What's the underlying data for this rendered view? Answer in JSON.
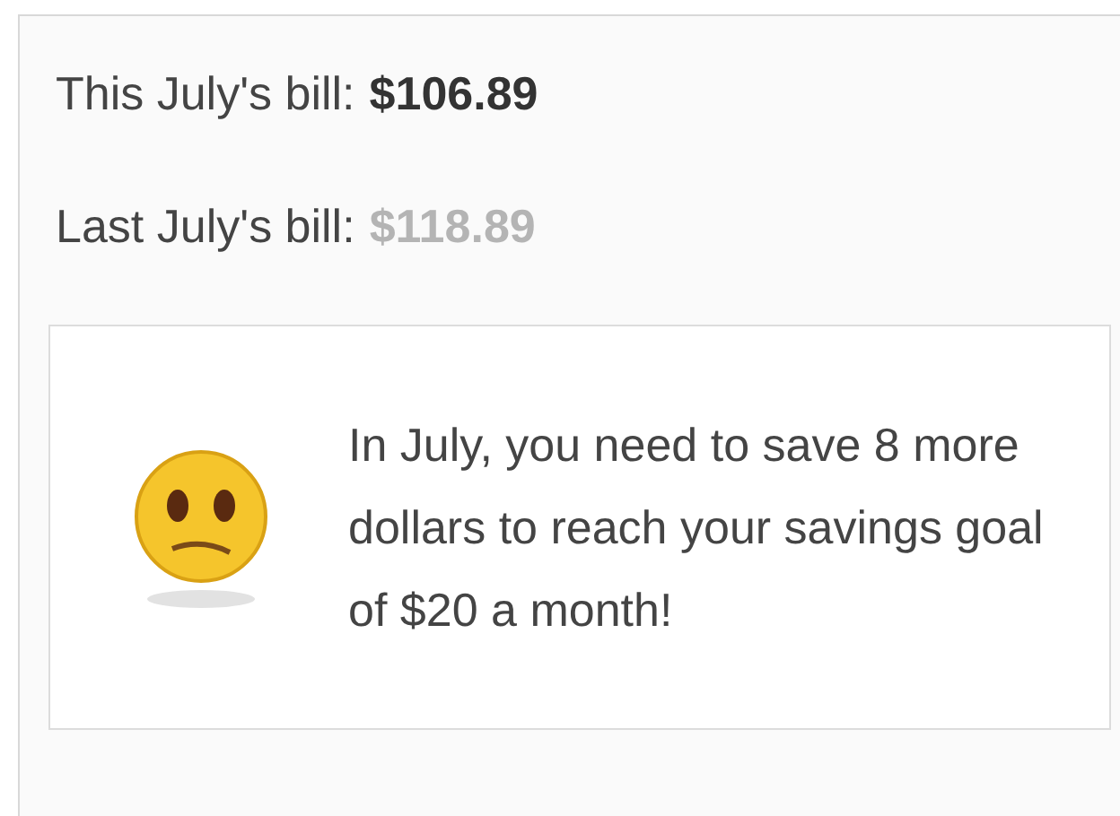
{
  "bills": [
    {
      "label": "This July's bill:",
      "amount": "$106.89",
      "muted": false
    },
    {
      "label": "Last July's bill:",
      "amount": "$118.89",
      "muted": true
    }
  ],
  "message": {
    "text": "In July, you need to save 8 more dollars to reach your savings goal of $20 a month!"
  }
}
